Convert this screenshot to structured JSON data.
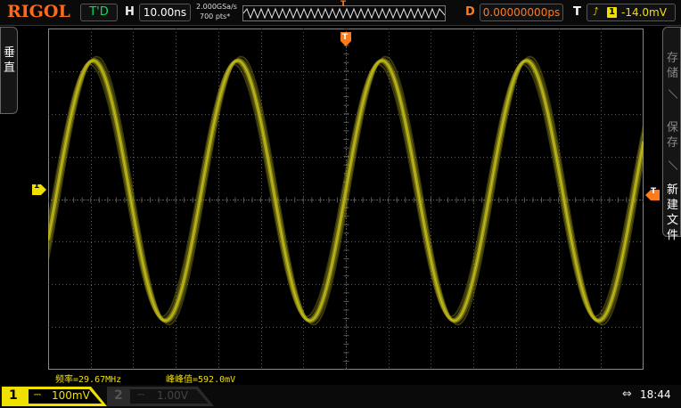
{
  "brand": {
    "logo": "RIGOL",
    "color": "#ff6a1a"
  },
  "status": {
    "run_state": "T'D",
    "horizontal_label": "H",
    "timebase": "10.00ns",
    "sample_rate": "2.000GSa/s",
    "points": "700 pts*",
    "trigger_marker": "T",
    "delay_label": "D",
    "delay_value": "0.00000000ps",
    "trigger_label": "T",
    "trigger_channel": "1",
    "trigger_level": "-14.0mV"
  },
  "left_menu": {
    "title": "垂直"
  },
  "right_menu": {
    "items": [
      {
        "label": "存储"
      },
      {
        "label": "保存"
      },
      {
        "label": "新建文件"
      }
    ]
  },
  "markers": {
    "channel1": "1",
    "trigger_top": "T",
    "trigger_right": "T"
  },
  "measurements": {
    "frequency": "频率=29.67MHz",
    "peak_to_peak": "峰峰值=592.0mV"
  },
  "channels": [
    {
      "num": "1",
      "coupling": "⎓",
      "scale": "100mV",
      "color": "#f0e000"
    },
    {
      "num": "2",
      "coupling": "⎓",
      "scale": "1.00V",
      "color": "#00d8ff"
    }
  ],
  "system": {
    "usb": "⇔",
    "time": "18:44"
  },
  "colors": {
    "channel1": "#f0e000",
    "trace": "#a6a21c",
    "trigger": "#ff7a1a",
    "grid": "#5a5a5a"
  }
}
